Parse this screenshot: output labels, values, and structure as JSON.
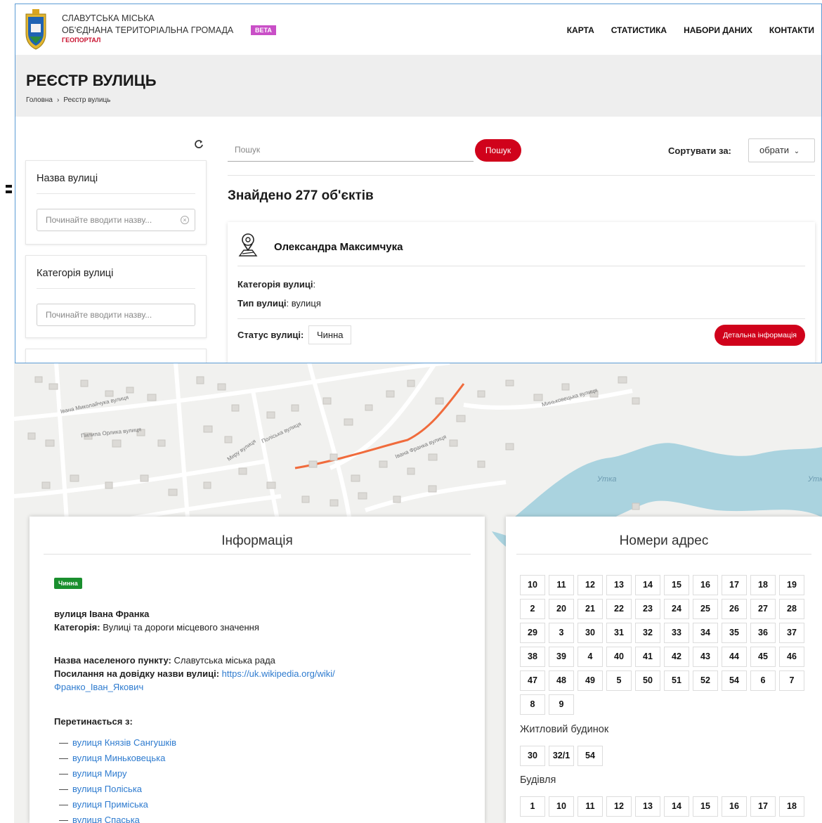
{
  "header": {
    "brand_line1": "СЛАВУТСЬКА МІСЬКА",
    "brand_line2": "ОБ'ЄДНАНА ТЕРИТОРІАЛЬНА ГРОМАДА",
    "brand_line3": "ГЕОПОРТАЛ",
    "beta": "BETA",
    "nav": [
      "КАРТА",
      "СТАТИСТИКА",
      "НАБОРИ ДАНИХ",
      "КОНТАКТИ"
    ]
  },
  "page": {
    "title": "РЕЄСТР ВУЛИЦЬ",
    "breadcrumb": [
      "Головна",
      "Реєстр вулиць"
    ]
  },
  "filters": [
    {
      "title": "Назва вулиці",
      "placeholder": "Починайте вводити назву..."
    },
    {
      "title": "Категорія вулиці",
      "placeholder": "Починайте вводити назву..."
    }
  ],
  "search": {
    "placeholder": "Пошук",
    "button": "Пошук",
    "sort_label": "Сортувати за:",
    "sort_value": "обрати"
  },
  "results": {
    "found_text": "Знайдено 277 об'єктів",
    "item": {
      "name": "Олександра Максимчука",
      "category_label": "Категорія вулиці",
      "category_value": "",
      "type_label": "Тип вулиці",
      "type_value": "вулиця",
      "status_label": "Статус вулиці:",
      "status_value": "Чинна",
      "detail_button": "Детальна інформація"
    }
  },
  "map": {
    "labels": [
      "Івана Миколайчука вулиця",
      "Пилипа Орлика вулиця",
      "Миру вулиця",
      "Поліська вулиця",
      "Івана Франка вулиця",
      "Миньковецька вулиця",
      "Утка",
      "Утка"
    ]
  },
  "info_panel": {
    "title": "Інформація",
    "status_badge": "Чинна",
    "street_name": "вулиця Івана Франка",
    "category_label": "Категорія:",
    "category_value": "Вулиці та дороги місцевого значення",
    "settlement_label": "Назва населеного пункту:",
    "settlement_value": "Славутська міська рада",
    "ref_label": "Посилання на довідку назви вулиці:",
    "ref_link_part1": "https://uk.wikipedia.org/wiki/",
    "ref_link_part2": "Франко_Іван_Якович",
    "intersects_label": "Перетинається з:",
    "intersects": [
      "вулиця Князів Сангушків",
      "вулиця Миньковецька",
      "вулиця Миру",
      "вулиця Поліська",
      "вулиця Приміська",
      "вулиця Спаська"
    ]
  },
  "address_panel": {
    "title": "Номери адрес",
    "main_numbers": [
      "10",
      "11",
      "12",
      "13",
      "14",
      "15",
      "16",
      "17",
      "18",
      "19",
      "2",
      "20",
      "21",
      "22",
      "23",
      "24",
      "25",
      "26",
      "27",
      "28",
      "29",
      "3",
      "30",
      "31",
      "32",
      "33",
      "34",
      "35",
      "36",
      "37",
      "38",
      "39",
      "4",
      "40",
      "41",
      "42",
      "43",
      "44",
      "45",
      "46",
      "47",
      "48",
      "49",
      "5",
      "50",
      "51",
      "52",
      "54",
      "6",
      "7",
      "8",
      "9"
    ],
    "residential_label": "Житловий будинок",
    "residential_numbers": [
      "30",
      "32/1",
      "54"
    ],
    "building_label": "Будівля",
    "building_numbers": [
      "1",
      "10",
      "11",
      "12",
      "13",
      "14",
      "15",
      "16",
      "17",
      "18"
    ]
  },
  "colors": {
    "accent_red": "#d0021b",
    "beta_purple": "#c94fc7",
    "status_green": "#1a8f2e",
    "link_blue": "#2e7bcf",
    "water": "#aad3df"
  }
}
